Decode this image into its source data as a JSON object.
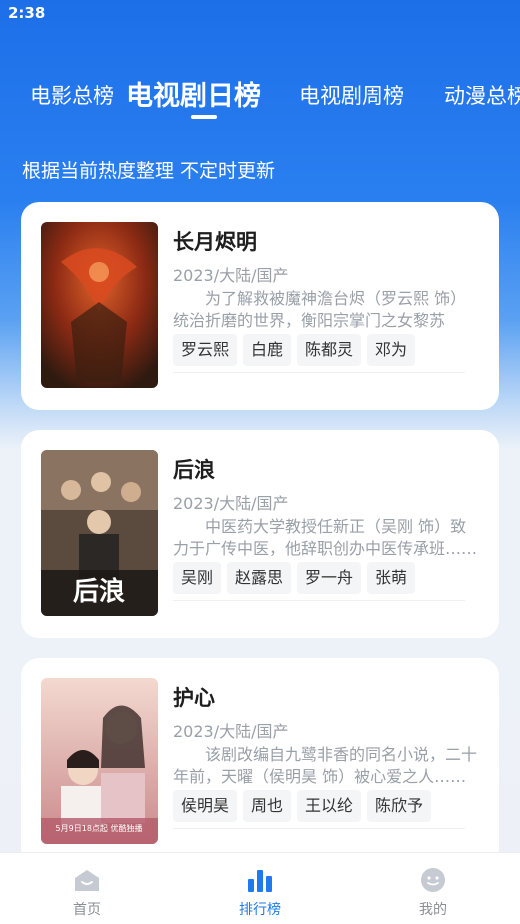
{
  "status_bar": {
    "time": "2:38"
  },
  "tabs": [
    {
      "label": "电影总榜",
      "active": false
    },
    {
      "label": "电视剧日榜",
      "active": true
    },
    {
      "label": "电视剧周榜",
      "active": false
    },
    {
      "label": "动漫总榜",
      "active": false
    }
  ],
  "subtitle": "根据当前热度整理 不定时更新",
  "items": [
    {
      "title": "长月烬明",
      "meta": "2023/大陆/国产",
      "desc": "为了解救被魔神澹台烬（罗云熙 饰）统治折磨的世界，衡阳宗掌门之女黎苏苏……",
      "actors": [
        "罗云熙",
        "白鹿",
        "陈都灵",
        "邓为"
      ]
    },
    {
      "title": "后浪",
      "meta": "2023/大陆/国产",
      "desc": "中医药大学教授任新正（吴刚 饰）致力于广传中医，他辞职创办中医传承班……",
      "actors": [
        "吴刚",
        "赵露思",
        "罗一舟",
        "张萌"
      ]
    },
    {
      "title": "护心",
      "meta": "2023/大陆/国产",
      "desc": "该剧改编自九鹭非香的同名小说，二十年前，天曜（侯明昊 饰）被心爱之人……",
      "actors": [
        "侯明昊",
        "周也",
        "王以纶",
        "陈欣予"
      ]
    }
  ],
  "posters": [
    {
      "text": "长月烬明",
      "colors": [
        "#6e1f12",
        "#c24a1c",
        "#2f1a10"
      ]
    },
    {
      "text": "后浪",
      "colors": [
        "#3a2f28",
        "#7a6450",
        "#1c1815"
      ]
    },
    {
      "text": "护心",
      "colors": [
        "#e8b7a8",
        "#c9898a",
        "#f3d9cf"
      ],
      "overlay": "5月9日18点起 优酷独播"
    }
  ],
  "bottom_nav": [
    {
      "label": "首页",
      "icon": "home-icon",
      "active": false
    },
    {
      "label": "排行榜",
      "icon": "ranking-icon",
      "active": true
    },
    {
      "label": "我的",
      "icon": "profile-icon",
      "active": false
    }
  ],
  "colors": {
    "accent": "#1f7aee",
    "header": "#1d6fe8"
  }
}
